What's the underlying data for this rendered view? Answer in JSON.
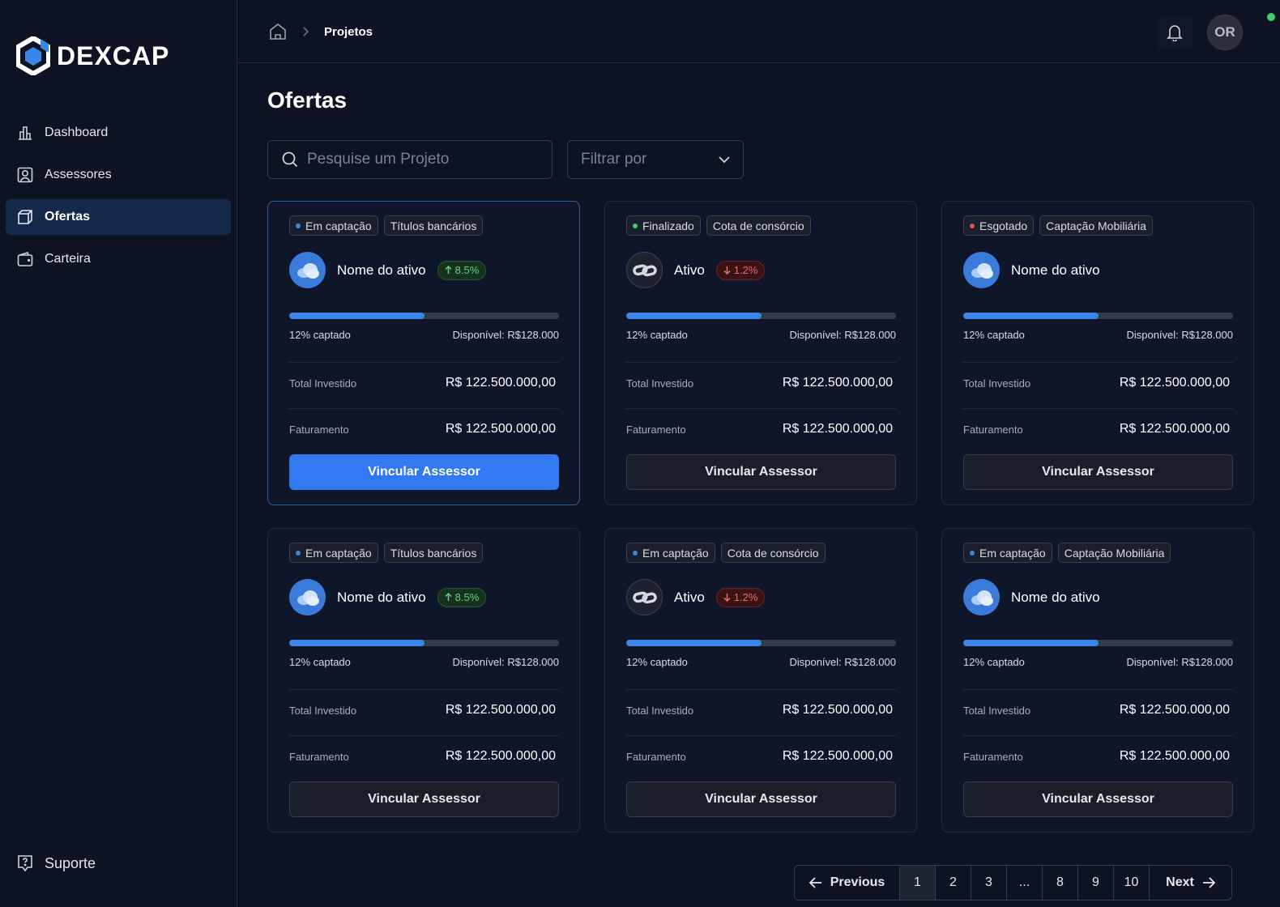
{
  "brand": {
    "name": "DEXCAP"
  },
  "sidebar": {
    "items": [
      {
        "label": "Dashboard",
        "icon": "bar-chart-icon",
        "active": false
      },
      {
        "label": "Assessores",
        "icon": "user-square-icon",
        "active": false
      },
      {
        "label": "Ofertas",
        "icon": "box-icon",
        "active": true
      },
      {
        "label": "Carteira",
        "icon": "wallet-icon",
        "active": false
      }
    ],
    "support_label": "Suporte"
  },
  "topbar": {
    "breadcrumb_current": "Projetos",
    "avatar_initials": "OR"
  },
  "main": {
    "title": "Ofertas",
    "search_placeholder": "Pesquise um Projeto",
    "filter_label": "Filtrar por"
  },
  "cards": [
    {
      "status": "Em captação",
      "status_color": "#3a86e8",
      "category": "Títulos bancários",
      "icon": "cloud",
      "asset": "Nome do ativo",
      "delta": "8.5%",
      "delta_dir": "up",
      "progress_fraction": 0.5,
      "captado": "12% captado",
      "disponivel": "Disponível: R$128.000",
      "total_label": "Total Investido",
      "total_value": "R$ 122.500.000,00",
      "fat_label": "Faturamento",
      "fat_value": "R$ 122.500.000,00",
      "button": "Vincular Assessor",
      "primary": true
    },
    {
      "status": "Finalizado",
      "status_color": "#3ecf6e",
      "category": "Cota de consórcio",
      "icon": "chain",
      "asset": "Ativo",
      "delta": "1.2%",
      "delta_dir": "down",
      "progress_fraction": 0.5,
      "captado": "12% captado",
      "disponivel": "Disponível: R$128.000",
      "total_label": "Total Investido",
      "total_value": "R$ 122.500.000,00",
      "fat_label": "Faturamento",
      "fat_value": "R$ 122.500.000,00",
      "button": "Vincular Assessor",
      "primary": false
    },
    {
      "status": "Esgotado",
      "status_color": "#e2504f",
      "category": "Captação Mobiliária",
      "icon": "cloud",
      "asset": "Nome do ativo",
      "delta": "",
      "delta_dir": "",
      "progress_fraction": 0.5,
      "captado": "12% captado",
      "disponivel": "Disponível: R$128.000",
      "total_label": "Total Investido",
      "total_value": "R$ 122.500.000,00",
      "fat_label": "Faturamento",
      "fat_value": "R$ 122.500.000,00",
      "button": "Vincular Assessor",
      "primary": false
    },
    {
      "status": "Em captação",
      "status_color": "#3a86e8",
      "category": "Títulos bancários",
      "icon": "cloud",
      "asset": "Nome do ativo",
      "delta": "8.5%",
      "delta_dir": "up",
      "progress_fraction": 0.5,
      "captado": "12% captado",
      "disponivel": "Disponível: R$128.000",
      "total_label": "Total Investido",
      "total_value": "R$ 122.500.000,00",
      "fat_label": "Faturamento",
      "fat_value": "R$ 122.500.000,00",
      "button": "Vincular Assessor",
      "primary": false
    },
    {
      "status": "Em captação",
      "status_color": "#3a86e8",
      "category": "Cota de consórcio",
      "icon": "chain",
      "asset": "Ativo",
      "delta": "1.2%",
      "delta_dir": "down",
      "progress_fraction": 0.5,
      "captado": "12% captado",
      "disponivel": "Disponível: R$128.000",
      "total_label": "Total Investido",
      "total_value": "R$ 122.500.000,00",
      "fat_label": "Faturamento",
      "fat_value": "R$ 122.500.000,00",
      "button": "Vincular Assessor",
      "primary": false
    },
    {
      "status": "Em captação",
      "status_color": "#3a86e8",
      "category": "Captação Mobiliária",
      "icon": "cloud",
      "asset": "Nome do ativo",
      "delta": "",
      "delta_dir": "",
      "progress_fraction": 0.5,
      "captado": "12% captado",
      "disponivel": "Disponível: R$128.000",
      "total_label": "Total Investido",
      "total_value": "R$ 122.500.000,00",
      "fat_label": "Faturamento",
      "fat_value": "R$ 122.500.000,00",
      "button": "Vincular Assessor",
      "primary": false
    }
  ],
  "pagination": {
    "prev_label": "Previous",
    "next_label": "Next",
    "pages": [
      "1",
      "2",
      "3",
      "...",
      "8",
      "9",
      "10"
    ],
    "current": "1"
  }
}
